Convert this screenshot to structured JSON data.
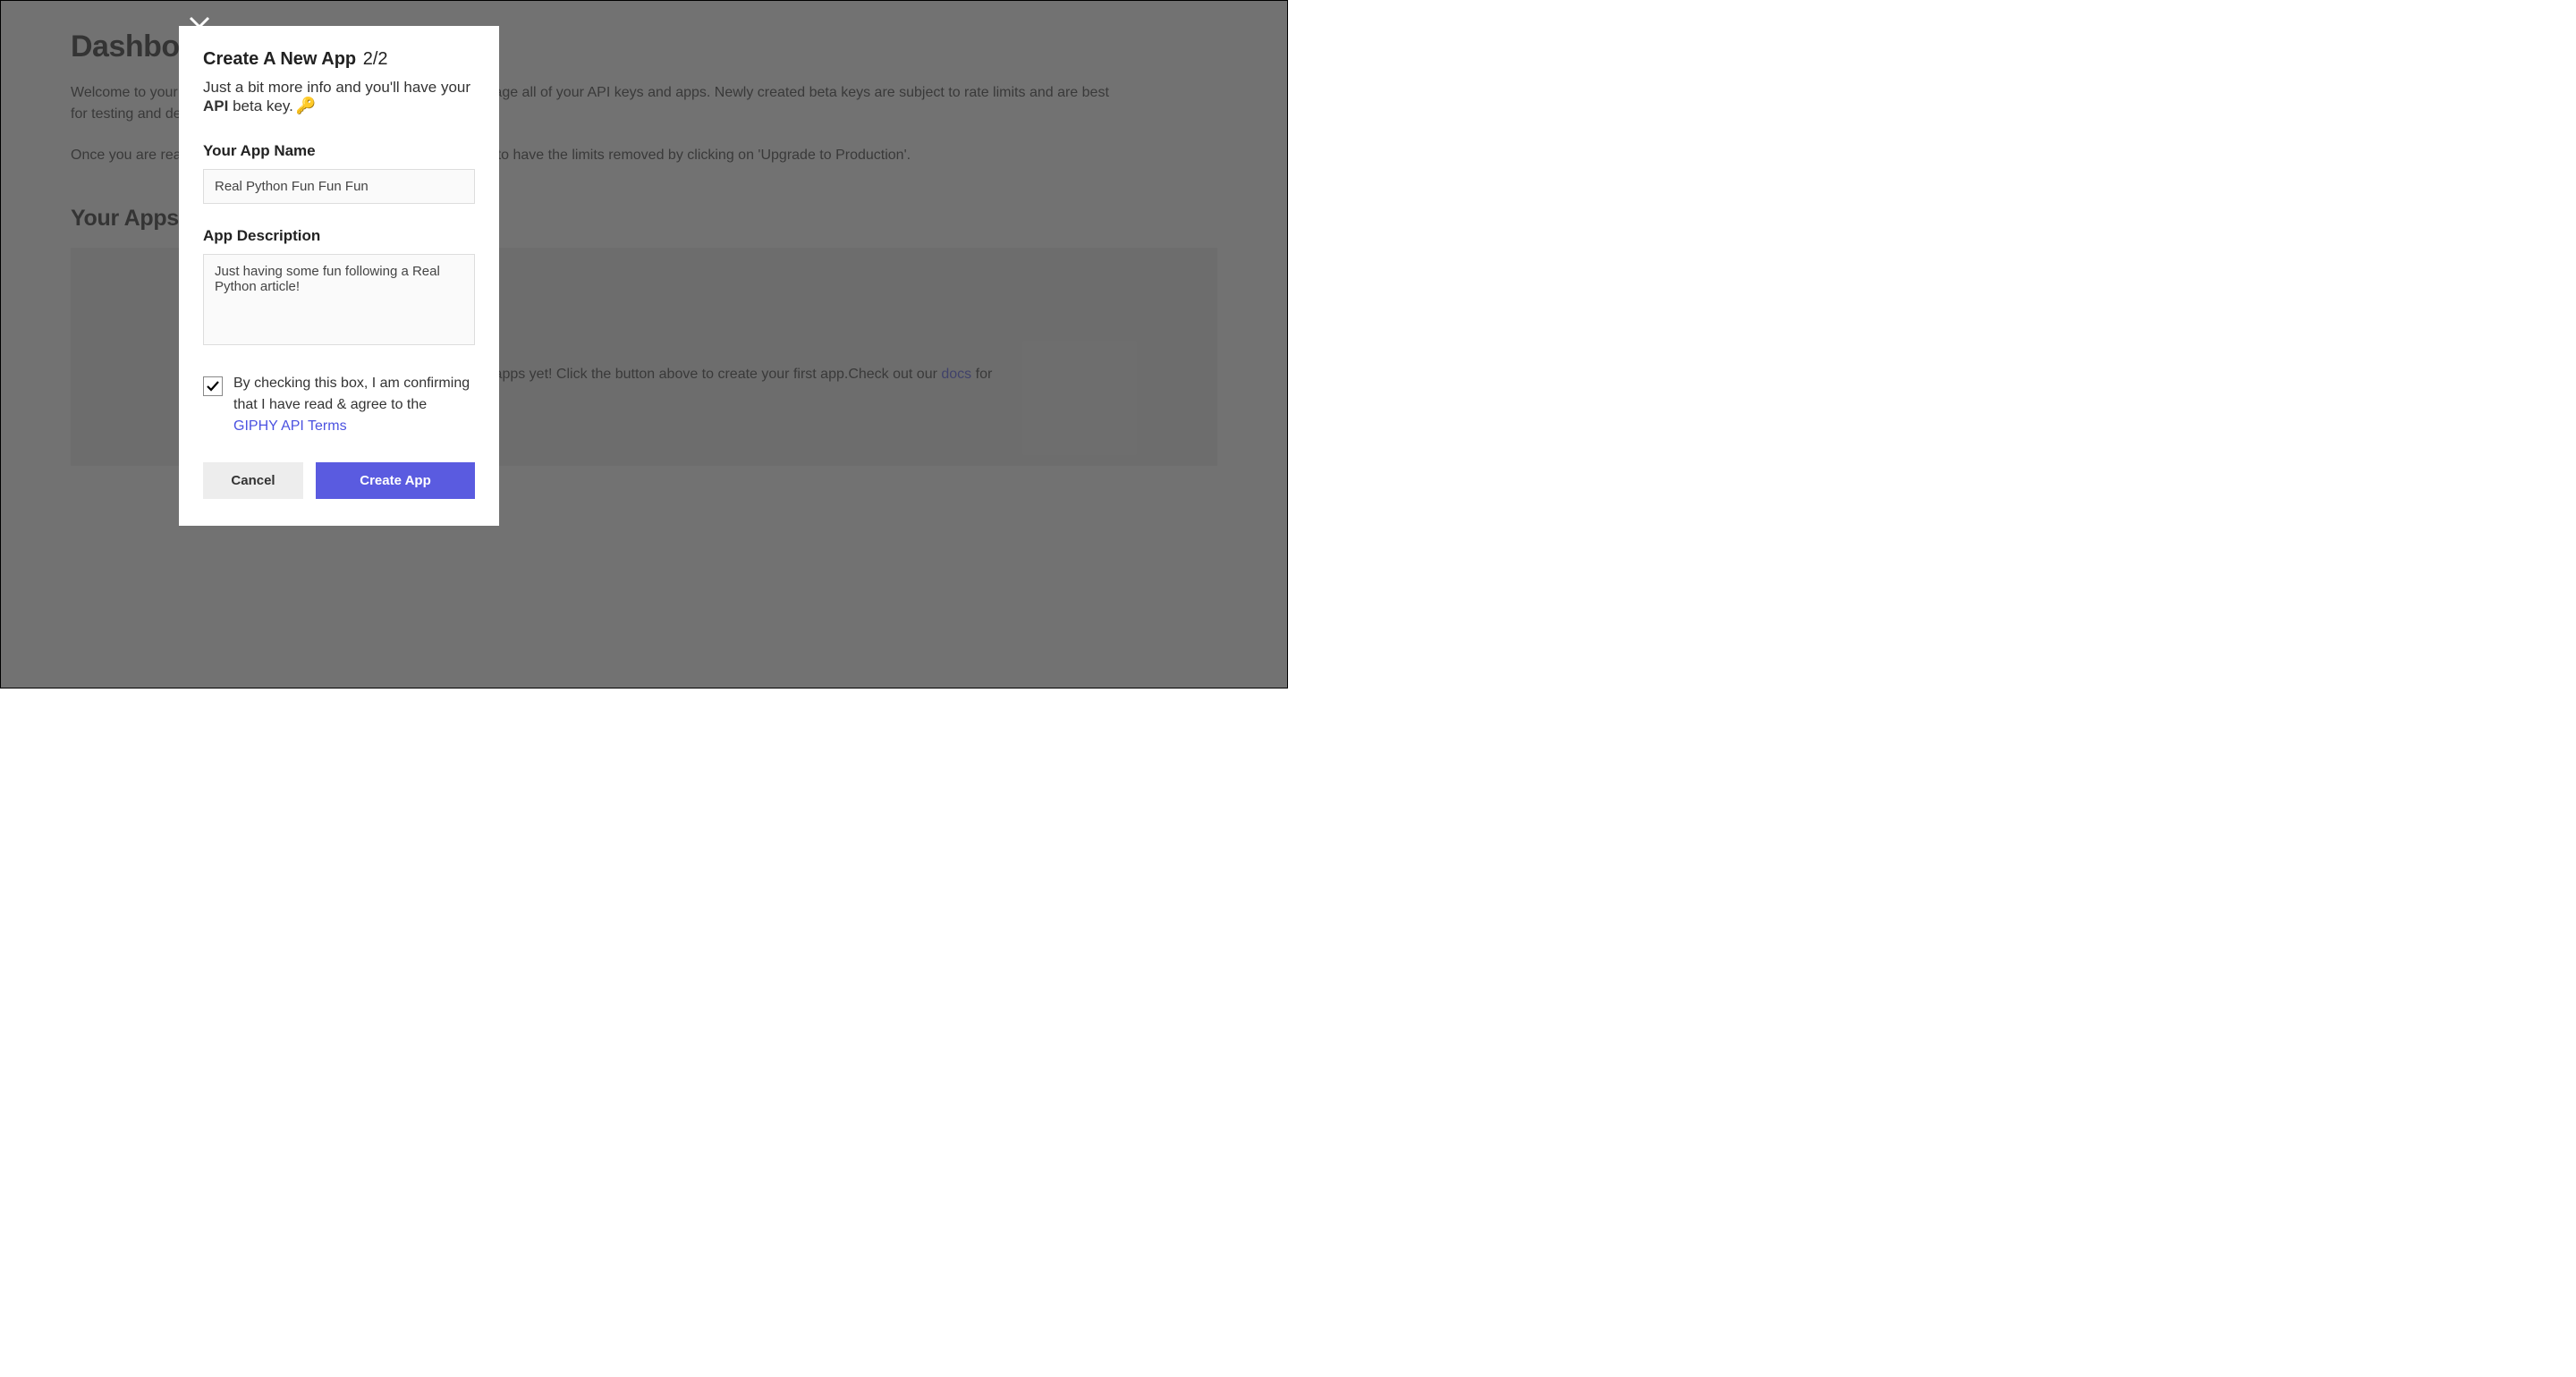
{
  "page": {
    "title": "Dashboard",
    "intro1": "Welcome to your GIPHY Developer Dashboard! Here you can manage all of your API keys and apps. Newly created beta keys are subject to rate limits and are best for testing and development.",
    "intro2": "Once you are ready to use your key in production, you can request to have the limits removed by clicking on 'Upgrade to Production'.",
    "section_title": "Your Apps",
    "empty_prefix": "It looks like you don't have any apps yet! Click the button above to create your first app.Check out our ",
    "empty_link": "docs",
    "empty_suffix": " for"
  },
  "modal": {
    "title": "Create A New App",
    "step": "2/2",
    "subtitle_prefix": "Just a bit more info and you'll have your ",
    "subtitle_bold": "API",
    "subtitle_suffix": " beta key.",
    "key_emoji": "🔑",
    "name_label": "Your App Name",
    "name_value": "Real Python Fun Fun Fun",
    "desc_label": "App Description",
    "desc_value": "Just having some fun following a Real Python article!",
    "terms_text": "By checking this box, I am confirming that I have read & agree to the ",
    "terms_link": "GIPHY API Terms",
    "checked": true,
    "cancel_label": "Cancel",
    "submit_label": "Create App"
  }
}
